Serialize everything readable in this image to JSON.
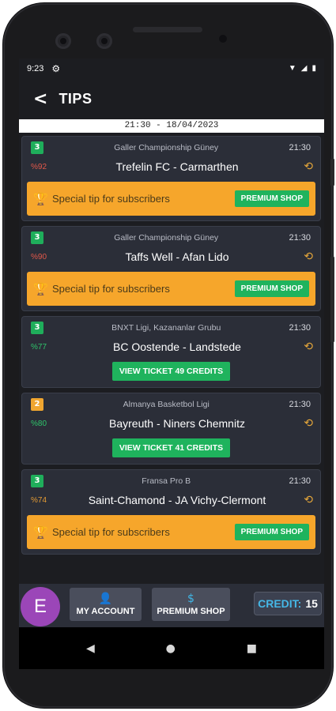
{
  "status": {
    "time": "9:23"
  },
  "header": {
    "title": "TIPS"
  },
  "date": "21:30 - 18/04/2023",
  "tips": [
    {
      "badge": "3",
      "badge_color": "#1fae5b",
      "league": "Galler Championship Güney",
      "time": "21:30",
      "percent": "%92",
      "percent_color": "red",
      "match": "Trefelin FC - Carmarthen",
      "special": "Special tip for subscribers",
      "action": "PREMIUM SHOP"
    },
    {
      "badge": "3",
      "badge_color": "#1fae5b",
      "league": "Galler Championship Güney",
      "time": "21:30",
      "percent": "%90",
      "percent_color": "red",
      "match": "Taffs Well - Afan Lido",
      "special": "Special tip for subscribers",
      "action": "PREMIUM SHOP"
    },
    {
      "badge": "3",
      "badge_color": "#1fae5b",
      "league": "BNXT Ligi, Kazananlar Grubu",
      "time": "21:30",
      "percent": "%77",
      "percent_color": "green",
      "match": "BC Oostende - Landstede",
      "ticket": "VIEW TICKET 49 CREDITS"
    },
    {
      "badge": "2",
      "badge_color": "#f0a630",
      "league": "Almanya Basketbol Ligi",
      "time": "21:30",
      "percent": "%80",
      "percent_color": "green",
      "match": "Bayreuth - Niners Chemnitz",
      "ticket": "VIEW TICKET 41 CREDITS"
    },
    {
      "badge": "3",
      "badge_color": "#1fae5b",
      "league": "Fransa Pro B",
      "time": "21:30",
      "percent": "%74",
      "percent_color": "orange",
      "match": "Saint-Chamond - JA Vichy-Clermont",
      "special": "Special tip for subscribers",
      "action": "PREMIUM SHOP"
    }
  ],
  "bottom": {
    "avatar_letter": "E",
    "my_account": "MY ACCOUNT",
    "premium_shop": "PREMIUM SHOP",
    "credit_label": "CREDIT:",
    "credit_value": "15"
  },
  "icons": {
    "back": "chevron-left-icon",
    "history": "history-clock-icon",
    "trophy": "trophy-icon",
    "user": "user-icon",
    "shop": "dollar-coin-icon"
  },
  "colors": {
    "accent_orange": "#f6a62b",
    "accent_green": "#1fb35d",
    "accent_blue": "#45b7e6",
    "avatar": "#9b46b8"
  }
}
